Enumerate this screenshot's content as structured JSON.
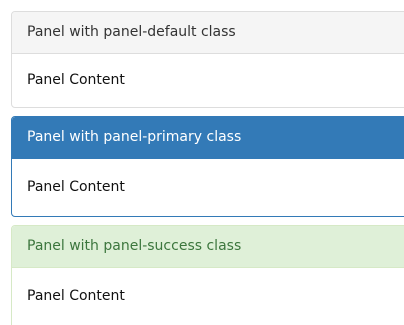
{
  "panels": [
    {
      "variant": "default",
      "heading": "Panel with panel-default class",
      "body": "Panel Content",
      "colors": {
        "heading_bg": "#f5f5f5",
        "heading_text": "#333333",
        "border": "#dddddd"
      }
    },
    {
      "variant": "primary",
      "heading": "Panel with panel-primary class",
      "body": "Panel Content",
      "colors": {
        "heading_bg": "#337ab7",
        "heading_text": "#ffffff",
        "border": "#337ab7"
      }
    },
    {
      "variant": "success",
      "heading": "Panel with panel-success class",
      "body": "Panel Content",
      "colors": {
        "heading_bg": "#dff0d8",
        "heading_text": "#3c763d",
        "border": "#d6e9c6"
      }
    }
  ]
}
